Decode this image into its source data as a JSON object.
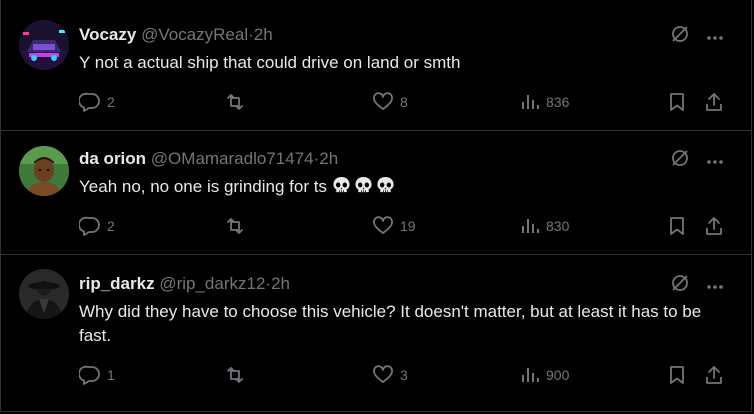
{
  "colors": {
    "background": "#000000",
    "divider": "#2f3336",
    "primary_text": "#e7e9ea",
    "secondary_text": "#71767b"
  },
  "replies": [
    {
      "name": "Vocazy",
      "handle": "@VocazyReal",
      "separator": "·",
      "time": "2h",
      "text": "Y not a actual ship that could drive on land or smth",
      "emoji_icons": [],
      "reply_count": "2",
      "repost_count": "",
      "like_count": "8",
      "view_count": "836"
    },
    {
      "name": "da orion",
      "handle": "@OMamaradlo71474",
      "separator": "·",
      "time": "2h",
      "text": "Yeah no, no one is grinding for ts",
      "emoji_icons": [
        "skull-icon",
        "skull-icon",
        "skull-icon"
      ],
      "reply_count": "2",
      "repost_count": "",
      "like_count": "19",
      "view_count": "830"
    },
    {
      "name": "rip_darkz",
      "handle": "@rip_darkz12",
      "separator": "·",
      "time": "2h",
      "text": "Why did they have to choose this vehicle? It doesn't matter, but at least it has to be fast.",
      "emoji_icons": [],
      "reply_count": "1",
      "repost_count": "",
      "like_count": "3",
      "view_count": "900"
    }
  ]
}
